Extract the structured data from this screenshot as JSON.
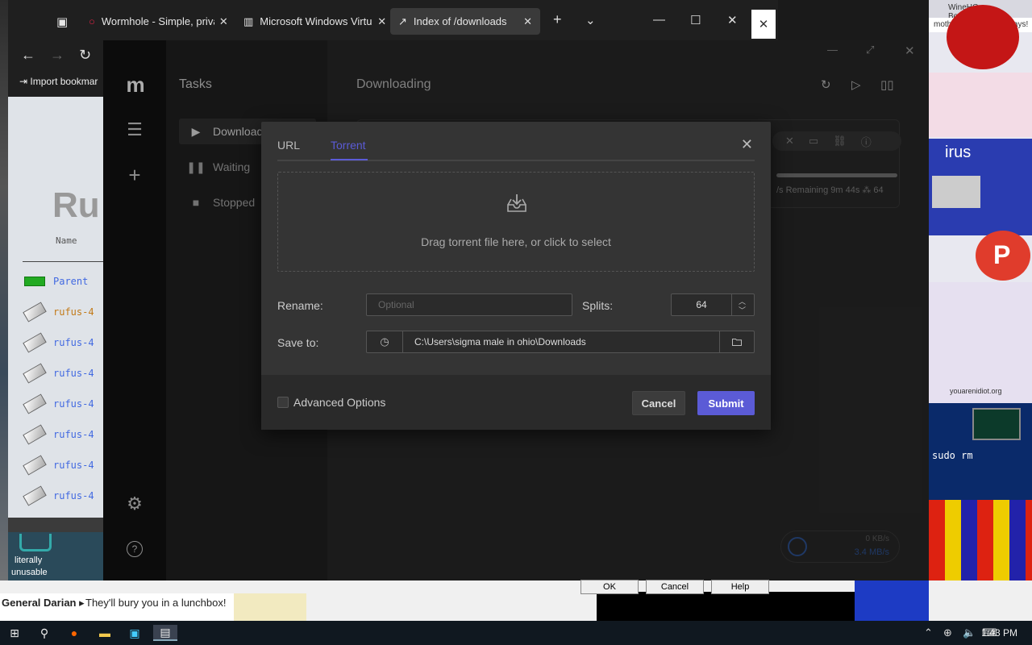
{
  "browser": {
    "tabs": [
      {
        "label": "Wormhole - Simple, priva",
        "close": "✕"
      },
      {
        "label": "Microsoft Windows Virtu",
        "close": "✕"
      },
      {
        "label": "Index of /downloads",
        "close": "✕"
      }
    ],
    "new_tab": "+",
    "import_bookmarks": "Import bookmar"
  },
  "background_page": {
    "heading": "Ru",
    "name_col": "Name",
    "parent": "Parent ",
    "files": [
      "rufus-4",
      "rufus-4",
      "rufus-4",
      "rufus-4",
      "rufus-4",
      "rufus-4",
      "rufus-4"
    ]
  },
  "desktop": {
    "icon_label_1": "literally",
    "icon_label_2": "unusable",
    "banner_1": "General Darian ▸",
    "banner_2": "They'll bury you in a lunchbox!",
    "right_text_1": "WineHQ - BonziBUDDY",
    "right_text_2": "motherfuckers these days!",
    "right_text_3": "irus",
    "right_text_4": "youarenidiot.org",
    "right_text_5": "sudo rm"
  },
  "app": {
    "sidebar_title": "Tasks",
    "nav": [
      {
        "label": "Download",
        "icon": "play-icon"
      },
      {
        "label": "Waiting",
        "icon": "pause-icon"
      },
      {
        "label": "Stopped",
        "icon": "stop-icon"
      }
    ],
    "main_title": "Downloading",
    "task": {
      "meta": "/s  Remaining 9m 44s  ⁂ 64"
    },
    "speed": {
      "up": "0 KB/s",
      "down": "3.4 MB/s"
    }
  },
  "dialog": {
    "tabs": [
      "URL",
      "Torrent"
    ],
    "active_tab": "Torrent",
    "dropzone_text": "Drag torrent file here, or click to select",
    "rename_label": "Rename:",
    "rename_placeholder": "Optional",
    "splits_label": "Splits:",
    "splits_value": "64",
    "save_to_label": "Save to:",
    "save_to_path": "C:\\Users\\sigma male in ohio\\Downloads",
    "advanced_label": "Advanced Options",
    "advanced_checked": false,
    "cancel_label": "Cancel",
    "submit_label": "Submit",
    "accent": "#5b5bd6"
  },
  "legacy_buttons": [
    "OK",
    "Cancel",
    "Help"
  ],
  "taskbar": {
    "time": "1:43 PM"
  }
}
